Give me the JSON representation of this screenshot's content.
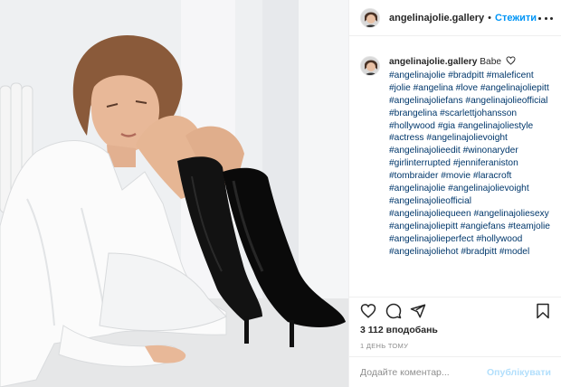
{
  "post": {
    "username": "angelinajolie.gallery",
    "separator": "•",
    "follow_label": "Стежити",
    "caption_text": "Babe",
    "hashtags": [
      "#angelinajolie",
      "#bradpitt",
      "#maleficent",
      "#jolie",
      "#angelina",
      "#love",
      "#angelinajoliepitt",
      "#angelinajoliefans",
      "#angelinajolieofficial",
      "#brangelina",
      "#scarlettjohansson",
      "#hollywood",
      "#gia",
      "#angelinajoliestyle",
      "#actress",
      "#angelinajolievoight",
      "#angelinajolieedit",
      "#winonaryder",
      "#girlinterrupted",
      "#jenniferaniston",
      "#tombraider",
      "#movie",
      "#laracroft",
      "#angelinajolie",
      "#angelinajolievoight",
      "#angelinajolieofficial",
      "#angelinajoliequeen",
      "#angelinajoliesexy",
      "#angelinajoliepitt",
      "#angiefans",
      "#teamjolie",
      "#angelinajolieperfect",
      "#hollywood",
      "#angelinajoliehot",
      "#bradpitt",
      "#model"
    ],
    "likes": "3 112 вподобань",
    "timestamp": "1 ДЕНЬ ТОМУ",
    "comment_placeholder": "Додайте коментар...",
    "post_button": "Опублікувати"
  },
  "icons": {
    "more": "more-icon",
    "heart": "heart-icon",
    "comment": "comment-icon",
    "share": "share-icon",
    "save": "bookmark-icon"
  },
  "colors": {
    "link": "#00376b",
    "follow": "#0095f6",
    "post_disabled": "#b2dffc",
    "muted": "#8e8e8e"
  }
}
